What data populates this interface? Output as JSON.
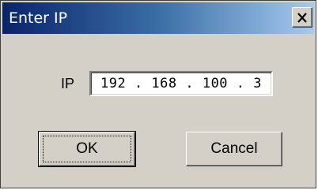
{
  "window": {
    "title": "Enter IP",
    "close_icon": "close-icon",
    "colors": {
      "titlebar_start": "#0a246a",
      "titlebar_end": "#a6caf0",
      "face": "#d4d0c8"
    }
  },
  "form": {
    "ip_label": "IP",
    "ip_value": "192.168.100.3"
  },
  "buttons": {
    "ok_label": "OK",
    "cancel_label": "Cancel"
  }
}
